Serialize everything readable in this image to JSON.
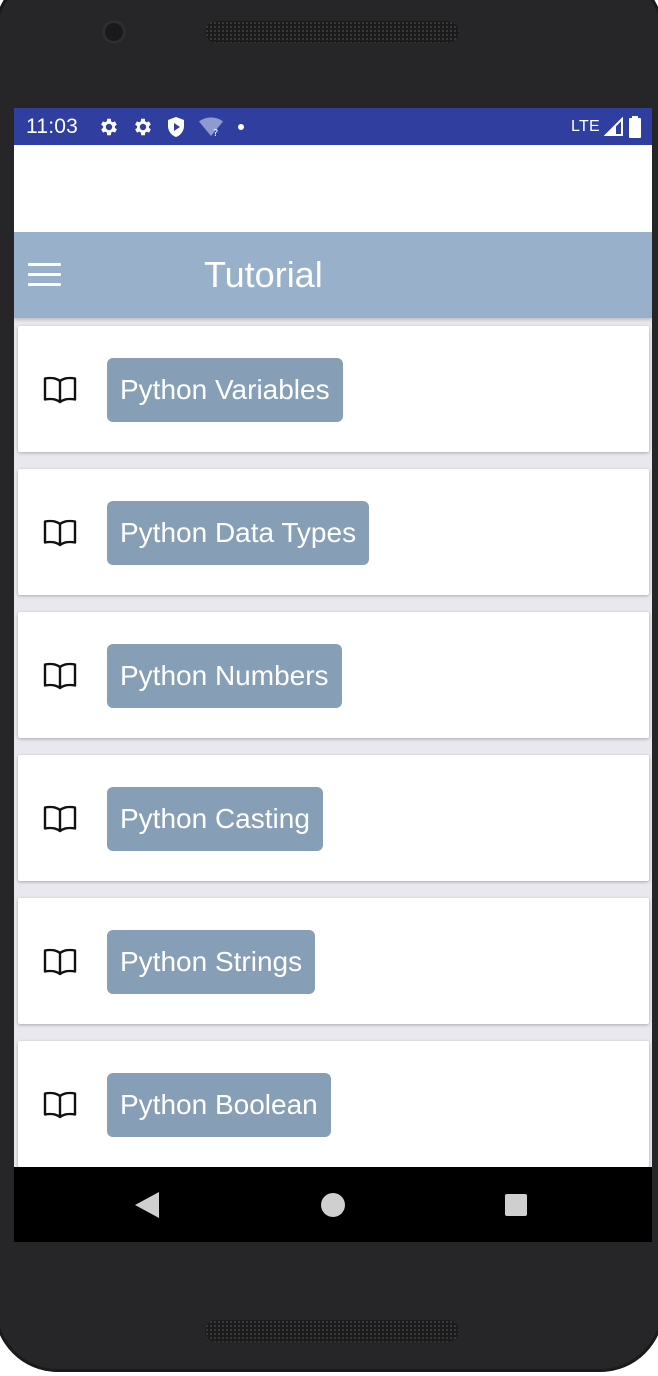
{
  "status_bar": {
    "time": "11:03",
    "network": "LTE",
    "icons": [
      "settings-icon",
      "settings-icon",
      "shield-icon",
      "wifi-unknown-icon",
      "notification-dot-icon",
      "signal-icon",
      "battery-icon"
    ]
  },
  "app_bar": {
    "title": "Tutorial",
    "menu_icon": "hamburger-menu-icon"
  },
  "topics": [
    {
      "label": "Python Variables",
      "icon": "book-icon"
    },
    {
      "label": "Python Data Types",
      "icon": "book-icon"
    },
    {
      "label": "Python Numbers",
      "icon": "book-icon"
    },
    {
      "label": "Python Casting",
      "icon": "book-icon"
    },
    {
      "label": "Python Strings",
      "icon": "book-icon"
    },
    {
      "label": "Python Boolean",
      "icon": "book-icon"
    }
  ],
  "nav_bar": {
    "icons": [
      "back-icon",
      "home-icon",
      "recents-icon"
    ]
  },
  "colors": {
    "status_bar": "#303f9f",
    "app_bar": "#98b0c9",
    "topic_button": "#879fb6",
    "list_background": "#e9e8ee"
  }
}
